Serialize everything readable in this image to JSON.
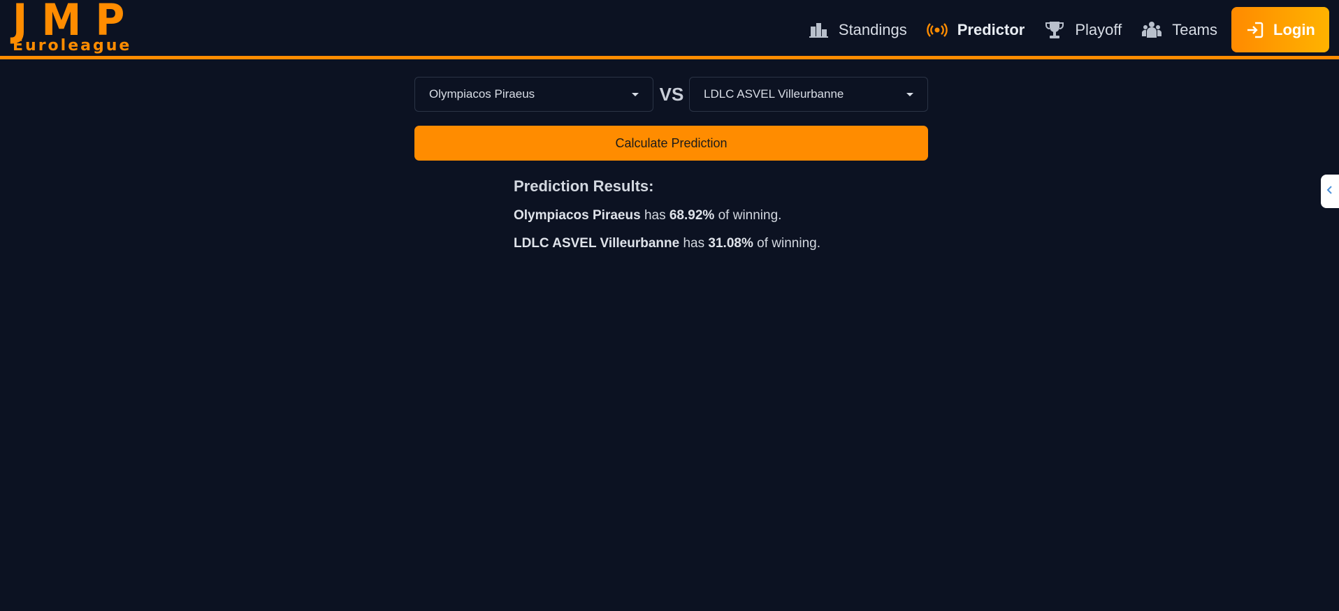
{
  "brand": {
    "logo_top": "JMP",
    "logo_bottom": "Euroleague"
  },
  "nav": {
    "items": [
      {
        "label": "Standings",
        "icon": "standings-icon"
      },
      {
        "label": "Predictor",
        "icon": "broadcast-icon",
        "active": true
      },
      {
        "label": "Playoff",
        "icon": "trophy-icon"
      },
      {
        "label": "Teams",
        "icon": "users-icon"
      }
    ],
    "login_label": "Login"
  },
  "matchup": {
    "home_team": "Olympiacos Piraeus",
    "vs_label": "VS",
    "away_team": "LDLC ASVEL Villeurbanne"
  },
  "calculate_label": "Calculate Prediction",
  "results": {
    "title": "Prediction Results:",
    "lines": [
      {
        "team": "Olympiacos Piraeus",
        "text_has": "has",
        "percent": "68.92%",
        "text_tail": "of winning."
      },
      {
        "team": "LDLC ASVEL Villeurbanne",
        "text_has": "has",
        "percent": "31.08%",
        "text_tail": "of winning."
      }
    ]
  },
  "colors": {
    "accent": "#ff8c00",
    "background": "#0c1222"
  }
}
